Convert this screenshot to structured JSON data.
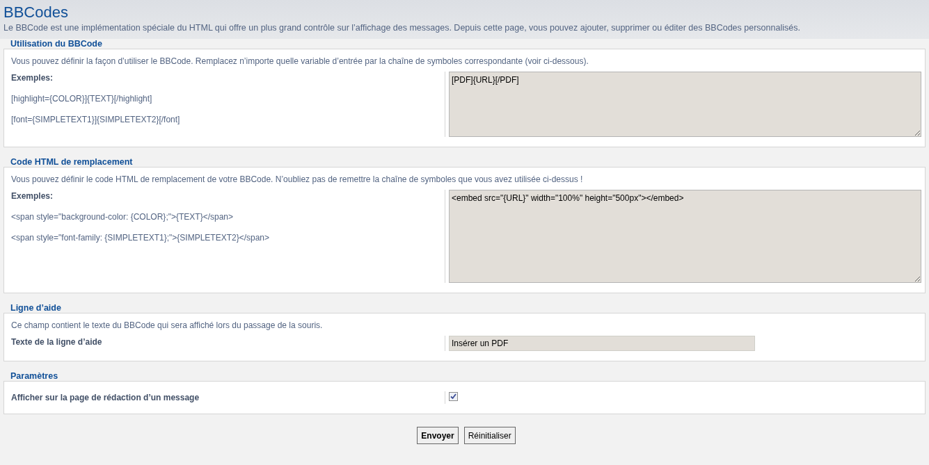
{
  "page": {
    "title": "BBCodes",
    "intro": "Le BBCode est une implémentation spéciale du HTML qui offre un plus grand contrôle sur l’affichage des messages. Depuis cette page, vous pouvez ajouter, supprimer ou éditer des BBCodes personnalisés."
  },
  "sections": [
    {
      "legend": "Utilisation du BBCode",
      "description": "Vous pouvez définir la façon d’utiliser le BBCode. Remplacez n’importe quelle variable d’entrée par la chaîne de symboles correspondante (voir ci-dessous).",
      "kind": "textarea",
      "tall": false,
      "label": "Exemples:",
      "examples": [
        "[highlight={COLOR}]{TEXT}[/highlight]",
        "[font={SIMPLETEXT1}]{SIMPLETEXT2}[/font]"
      ],
      "value": "[PDF]{URL}[/PDF]"
    },
    {
      "legend": "Code HTML de remplacement",
      "description": "Vous pouvez définir le code HTML de remplacement de votre BBCode. N’oubliez pas de remettre la chaîne de symboles que vous avez utilisée ci-dessus !",
      "kind": "textarea",
      "tall": true,
      "label": "Exemples:",
      "examples": [
        "<span style=\"background-color: {COLOR};\">{TEXT}</span>",
        "<span style=\"font-family: {SIMPLETEXT1};\">{SIMPLETEXT2}</span>"
      ],
      "value": "<embed src=\"{URL}\" width=\"100%\" height=\"500px\"></embed>"
    },
    {
      "legend": "Ligne d’aide",
      "description": "Ce champ contient le texte du BBCode qui sera affiché lors du passage de la souris.",
      "kind": "input",
      "label": "Texte de la ligne d’aide",
      "value": "Insérer un PDF"
    },
    {
      "legend": "Paramètres",
      "kind": "checkbox",
      "label": "Afficher sur la page de rédaction d’un message",
      "checked": true
    }
  ],
  "buttons": [
    {
      "label": "Envoyer",
      "primary": true
    },
    {
      "label": "Réinitialiser",
      "primary": false
    }
  ]
}
